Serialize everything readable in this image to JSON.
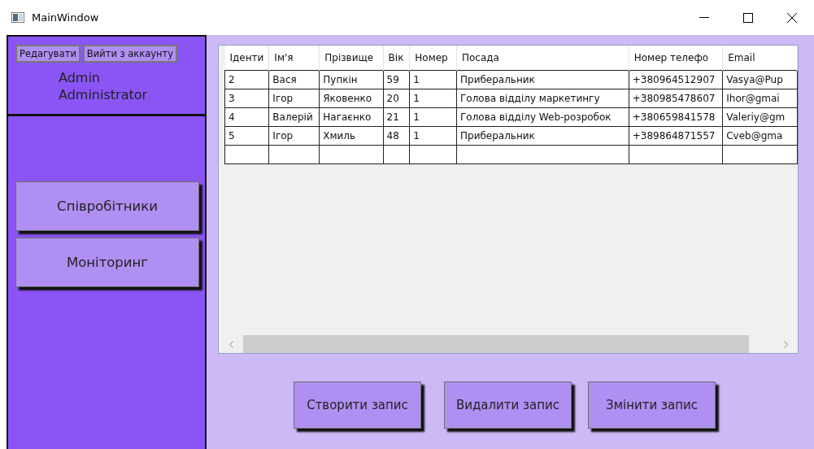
{
  "window": {
    "title": "MainWindow"
  },
  "sidebar": {
    "account_buttons": [
      "Редагувати",
      "Вийти з аккаунту"
    ],
    "user_name": "Admin",
    "user_role": "Administrator",
    "nav_items": [
      {
        "label": "Співробітники"
      },
      {
        "label": "Моніторинг"
      }
    ]
  },
  "table": {
    "columns": [
      "Іденти",
      "Ім'я",
      "Прізвище",
      "Вік",
      "Номер",
      "Посада",
      "Номер телефо",
      "Email"
    ],
    "rows": [
      [
        "2",
        "Вася",
        "Пупкін",
        "59",
        "1",
        "Приберальник",
        "+380964512907",
        "Vasya@Pup"
      ],
      [
        "3",
        "Ігор",
        "Яковенко",
        "20",
        "1",
        "Голова відділу маркетингу",
        "+380985478607",
        "Ihor@gmai"
      ],
      [
        "4",
        "Валерій",
        "Нагаєнко",
        "21",
        "1",
        "Голова відділу Web-розробок",
        "+380659841578",
        "Valeriy@gm"
      ],
      [
        "5",
        "Ігор",
        "Хмиль",
        "48",
        "1",
        "Приберальник",
        "+389864871557",
        "Cveb@gma"
      ]
    ]
  },
  "actions": [
    "Створити запис",
    "Видалити запис",
    "Змінити запис"
  ]
}
